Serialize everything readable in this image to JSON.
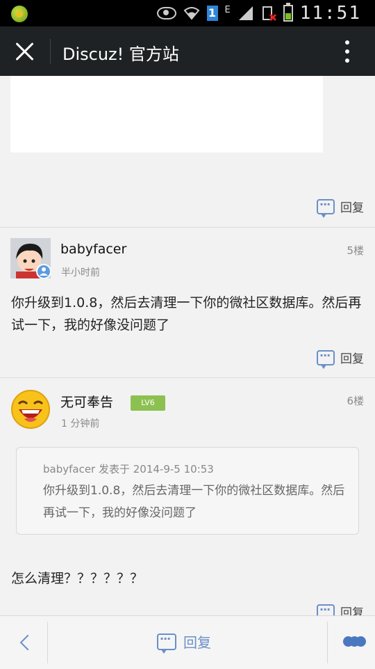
{
  "status_bar": {
    "time": "11:51",
    "network_label": "E",
    "sim": "1"
  },
  "header": {
    "title": "Discuz! 官方站"
  },
  "reply_label": "回复",
  "posts": [
    {
      "author": "babyfacer",
      "time": "半小时前",
      "floor": "5楼",
      "body": "你升级到1.0.8，然后去清理一下你的微社区数据库。然后再试一下，我的好像没问题了"
    },
    {
      "author": "无可奉告",
      "badge": "LV6",
      "time": "1 分钟前",
      "floor": "6楼",
      "quote": {
        "meta": "babyfacer 发表于 2014-9-5 10:53",
        "text": "你升级到1.0.8，然后去清理一下你的微社区数据库。然后再试一下，我的好像没问题了"
      },
      "body": "怎么清理？？？？？？"
    }
  ],
  "bottom_bar": {
    "reply_label": "回复"
  },
  "colors": {
    "accent": "#6a8fc7",
    "titlebar": "#1f2224",
    "level_badge": "#8cc152"
  }
}
